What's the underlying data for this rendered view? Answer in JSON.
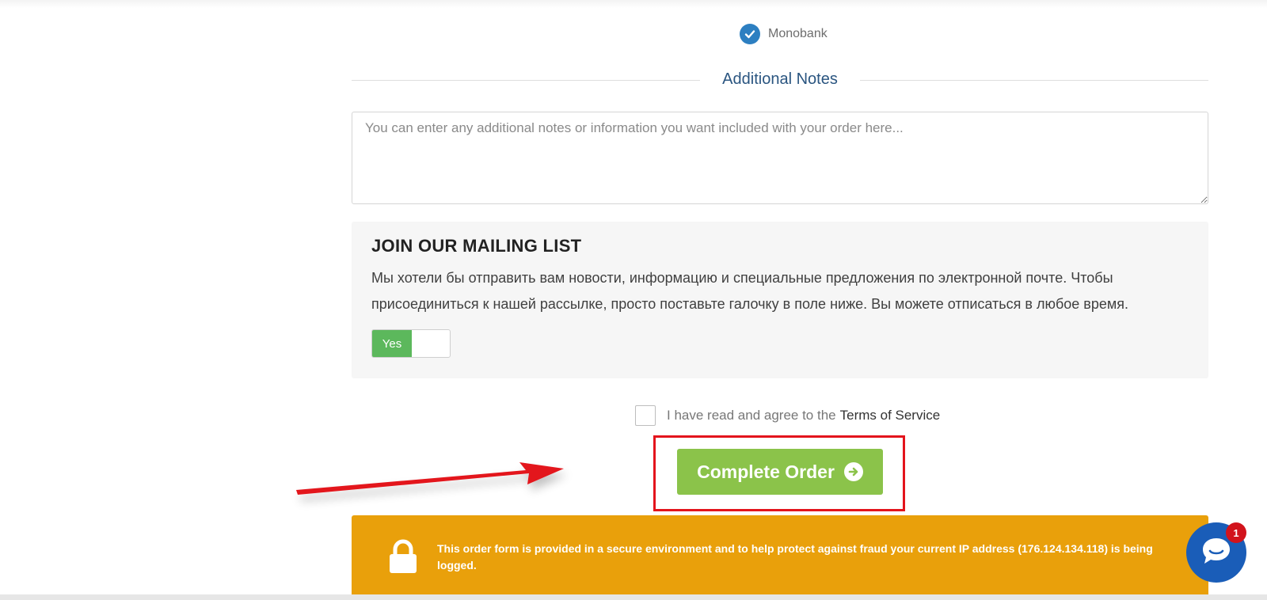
{
  "payment": {
    "selected_method": "Monobank",
    "check_color": "#2d7fc1"
  },
  "notes_section": {
    "title": "Additional Notes",
    "placeholder": "You can enter any additional notes or information you want included with your order here..."
  },
  "mailing_list": {
    "title": "JOIN OUR MAILING LIST",
    "description": "Мы хотели бы отправить вам новости, информацию и специальные предложения по электронной почте. Чтобы присоединиться к нашей рассылке, просто поставьте галочку в поле ниже. Вы можете отписаться в любое время.",
    "toggle_label": "Yes",
    "toggle_on": true,
    "toggle_color": "#5cb85c"
  },
  "terms": {
    "prefix": "I have read and agree to the",
    "link_label": "Terms of Service",
    "checked": false
  },
  "checkout": {
    "button_label": "Complete Order",
    "button_icon": "arrow-circle-right-icon",
    "button_color": "#8bc34a"
  },
  "security_notice": {
    "text": "This order form is provided in a secure environment and to help protect against fraud your current IP address (176.124.134.118) is being logged.",
    "icon": "lock-icon",
    "banner_color": "#e9a00b"
  },
  "chat": {
    "badge_count": "1",
    "icon": "chat-bubble-icon",
    "color": "#1a5db8"
  },
  "annotation": {
    "highlight_color": "#e3141c"
  }
}
